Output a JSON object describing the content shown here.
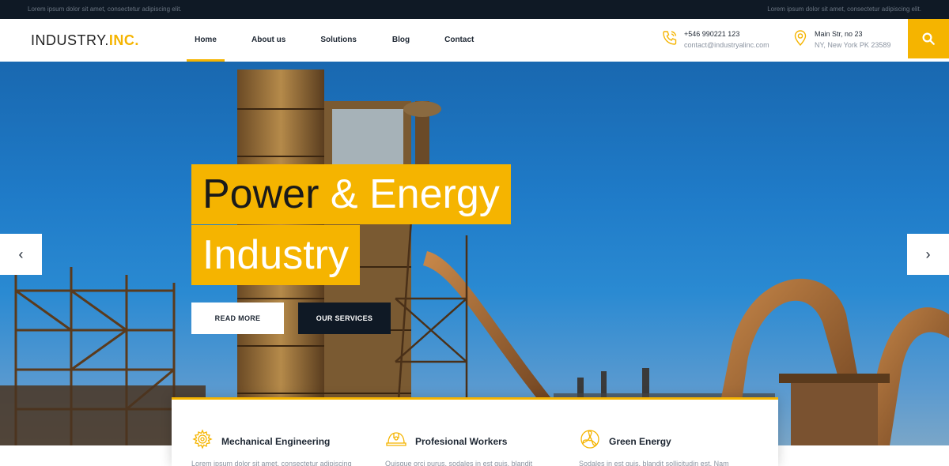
{
  "topbar": {
    "left_text": "Lorem ipsum dolor sit amet, consectetur adipiscing elit.",
    "right_text": "Lorem ipsum dolor sit amet, consectetur adipiscing elit."
  },
  "header": {
    "logo_main": "INDUSTRY.",
    "logo_accent": "INC.",
    "nav": [
      "Home",
      "About us",
      "Solutions",
      "Blog",
      "Contact"
    ],
    "active_nav": "Home",
    "phone": "+546 990221 123",
    "email": "contact@industryalinc.com",
    "address_line1": "Main Str, no 23",
    "address_line2": "NY, New York PK 23589",
    "icons": {
      "phone": "phone-icon",
      "location": "location-pin-icon",
      "search": "search-icon"
    }
  },
  "hero": {
    "title_dark": "Power",
    "title_light": "& Energy",
    "title_line2": "Industry",
    "read_more": "READ MORE",
    "our_services": "OUR SERVICES",
    "prev_arrow": "‹",
    "next_arrow": "›"
  },
  "features": [
    {
      "title": "Mechanical Engineering",
      "text": "Lorem ipsum dolor sit amet, consectetur adipiscing",
      "icon": "gear-icon"
    },
    {
      "title": "Profesional Workers",
      "text": "Quisque orci purus, sodales in est quis, blandit",
      "icon": "hard-hat-icon"
    },
    {
      "title": "Green Energy",
      "text": "Sodales in est quis, blandit sollicitudin est. Nam",
      "icon": "wind-turbine-icon"
    }
  ],
  "colors": {
    "accent": "#f5b400",
    "dark": "#0f1925",
    "sky": "#1f7bc8"
  }
}
